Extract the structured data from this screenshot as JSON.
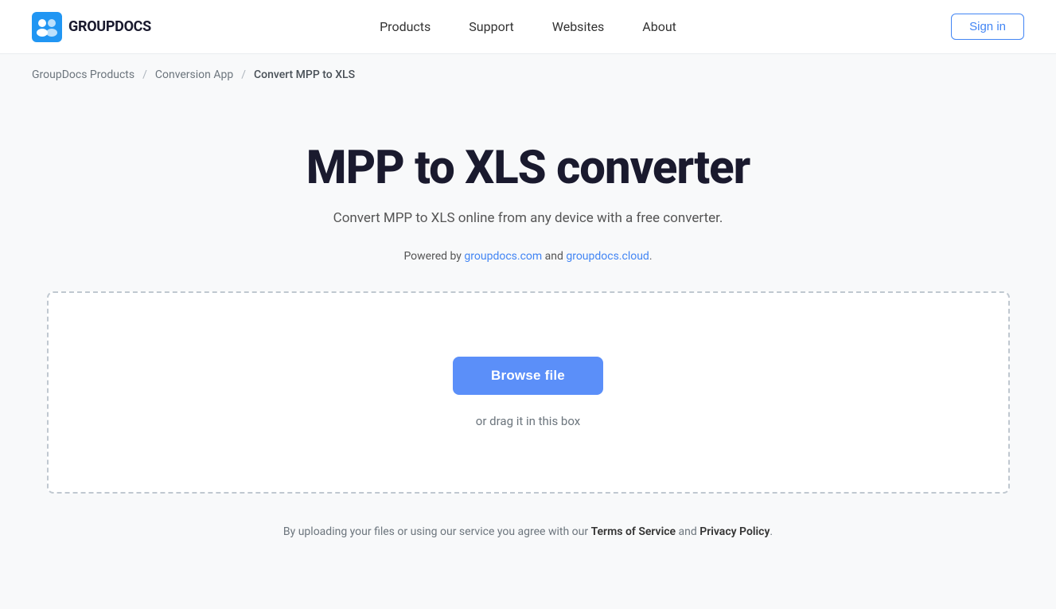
{
  "header": {
    "logo_text": "GROUPDOCS",
    "nav": {
      "products": "Products",
      "support": "Support",
      "websites": "Websites",
      "about": "About"
    },
    "signin_label": "Sign in"
  },
  "breadcrumb": {
    "item1": "GroupDocs Products",
    "sep1": "/",
    "item2": "Conversion App",
    "sep2": "/",
    "item3": "Convert MPP to XLS"
  },
  "main": {
    "title": "MPP to XLS converter",
    "subtitle": "Convert MPP to XLS online from any device with a free converter.",
    "powered_by_prefix": "Powered by ",
    "powered_link1": "groupdocs.com",
    "powered_by_and": " and ",
    "powered_link2": "groupdocs.cloud",
    "powered_by_suffix": ".",
    "drop_zone": {
      "browse_label": "Browse file",
      "drag_text": "or drag it in this box"
    },
    "footer_note_prefix": "By uploading your files or using our service you agree with our ",
    "terms_label": "Terms of Service",
    "footer_note_and": " and ",
    "privacy_label": "Privacy Policy",
    "footer_note_suffix": "."
  }
}
